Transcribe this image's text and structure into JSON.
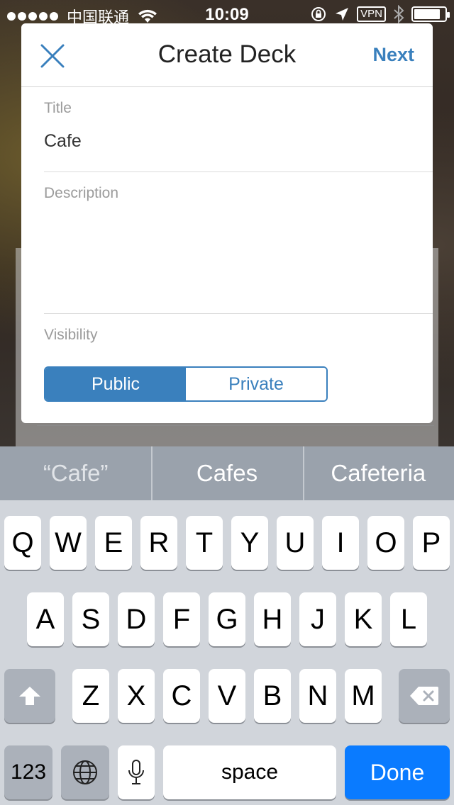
{
  "status_bar": {
    "carrier": "中国联通",
    "time": "10:09",
    "vpn": "VPN",
    "battery_level": 0.85
  },
  "modal": {
    "title": "Create Deck",
    "next_label": "Next",
    "title_label": "Title",
    "title_value": "Cafe",
    "description_label": "Description",
    "description_value": "",
    "visibility_label": "Visibility",
    "visibility_options": [
      "Public",
      "Private"
    ],
    "visibility_selected": "Public"
  },
  "keyboard": {
    "suggestions": [
      "“Cafe”",
      "Cafes",
      "Cafeteria"
    ],
    "row1": [
      "Q",
      "W",
      "E",
      "R",
      "T",
      "Y",
      "U",
      "I",
      "O",
      "P"
    ],
    "row2": [
      "A",
      "S",
      "D",
      "F",
      "G",
      "H",
      "J",
      "K",
      "L"
    ],
    "row3": [
      "Z",
      "X",
      "C",
      "V",
      "B",
      "N",
      "M"
    ],
    "numbers_label": "123",
    "space_label": "space",
    "done_label": "Done"
  },
  "colors": {
    "accent": "#3a80bd",
    "done_key": "#0a7bff"
  }
}
